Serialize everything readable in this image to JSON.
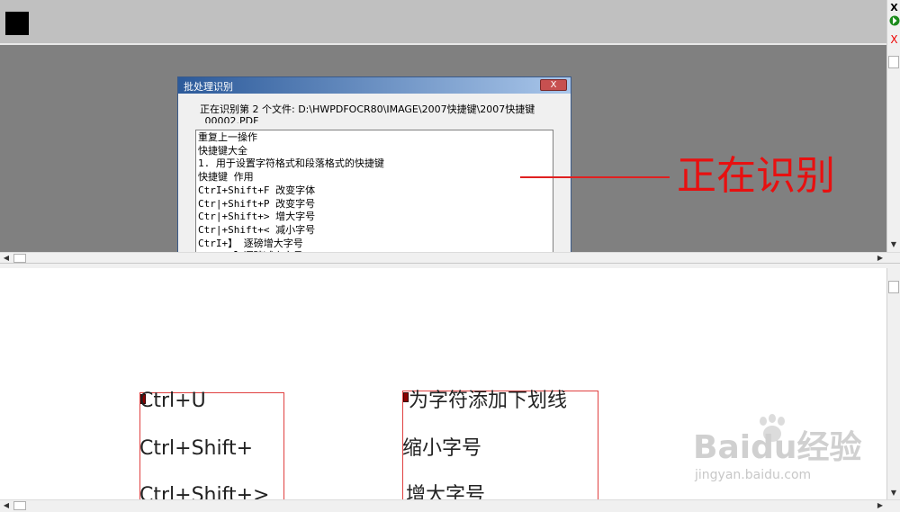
{
  "dialog": {
    "title": "批处理识别",
    "close_label": "X",
    "status_text": "正在识别第 2 个文件:  D:\\HWPDFOCR80\\IMAGE\\2007快捷键\\2007快捷键_00002.PDF",
    "lines": [
      "重复上一操作",
      "快捷键大全",
      "1. 用于设置字符格式和段落格式的快捷键",
      "快捷键 作用",
      "CtrI+Shift+F 改变字体",
      "Ctr|+Shift+P 改变字号",
      "Ctr|+Shift+> 增大字号",
      "Ctr|+Shift+< 减小字号",
      "CtrI+】 逐磅增大字号",
      "Ctrl+【 逐磅减小字号"
    ]
  },
  "annotation": {
    "text": "正在识别"
  },
  "right_controls": {
    "x_black": "X",
    "green_icon": "green-arrow-icon",
    "x_red": "X"
  },
  "bottom": {
    "left_lines": [
      "Ctrl+U",
      "Ctrl+Shift+",
      "Ctrl+Shift+>"
    ],
    "right_lines": [
      "为字符添加下划线",
      "缩小字号",
      "增大字号"
    ]
  },
  "watermark": {
    "main": "Baidu经验",
    "sub": "jingyan.baidu.com"
  },
  "colors": {
    "accent_red": "#e81010",
    "box_red": "#e04040",
    "title_blue": "#2c5a9a"
  }
}
